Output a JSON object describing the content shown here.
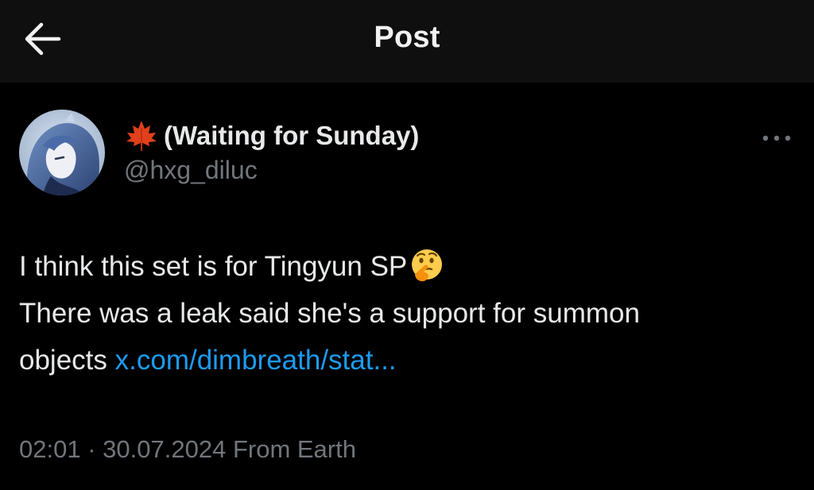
{
  "header": {
    "title": "Post",
    "back_icon": "arrow-left-icon"
  },
  "post": {
    "author": {
      "name_emoji_icon": "maple-leaf-icon",
      "display_name": "(Waiting for Sunday)",
      "handle": "@hxg_diluc"
    },
    "more_icon": "more-horizontal-icon",
    "text": {
      "line1": "I think this set is for Tingyun SP",
      "line1_emoji_icon": "thinking-face-icon",
      "line2": "There was a leak said she's a support for summon",
      "line3_prefix": "objects ",
      "link": "x.com/dimbreath/stat..."
    },
    "meta": {
      "time": "02:01",
      "separator": "·",
      "date": "30.07.2024",
      "source": "From Earth"
    }
  },
  "colors": {
    "background": "#000000",
    "header_background": "#0f0f0f",
    "text_primary": "#e7e9ea",
    "text_secondary": "#71767b",
    "link": "#1d9bf0"
  }
}
